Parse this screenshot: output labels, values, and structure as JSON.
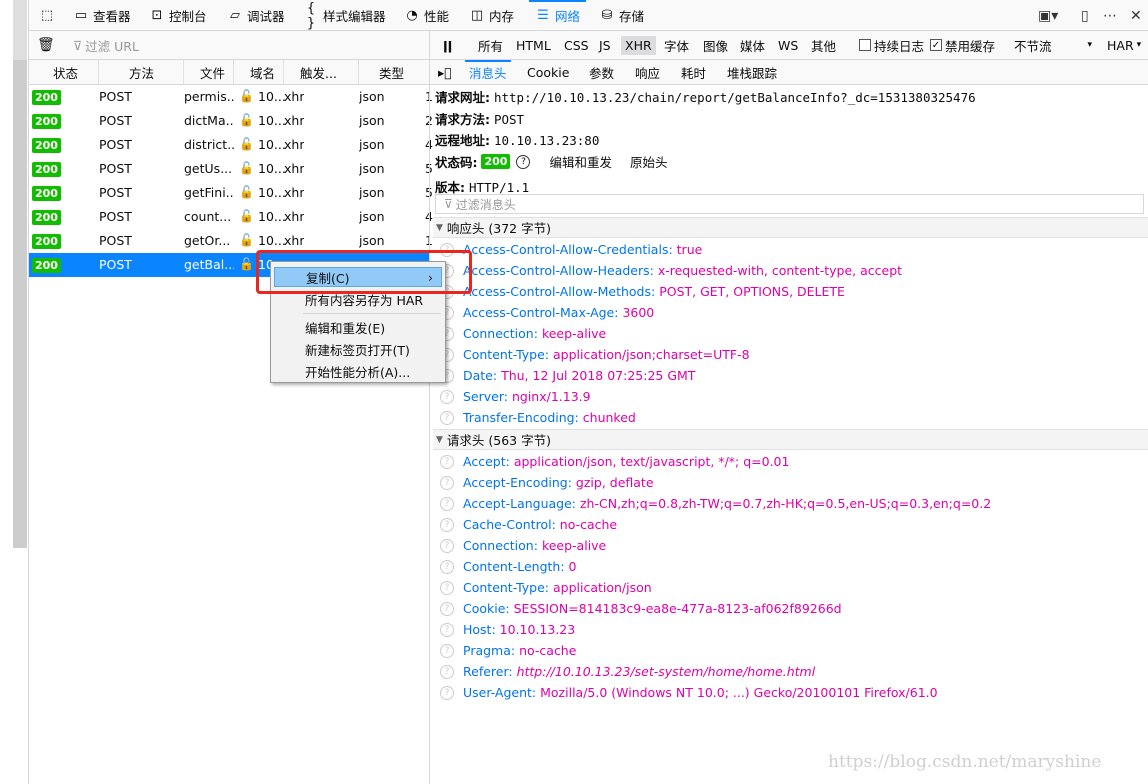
{
  "toolbox": {
    "tabs": [
      {
        "label": "查看器",
        "icon": "inspector-icon"
      },
      {
        "label": "控制台",
        "icon": "console-icon"
      },
      {
        "label": "调试器",
        "icon": "debugger-icon"
      },
      {
        "label": "样式编辑器",
        "icon": "style-editor-icon"
      },
      {
        "label": "性能",
        "icon": "performance-icon"
      },
      {
        "label": "内存",
        "icon": "memory-icon"
      },
      {
        "label": "网络",
        "icon": "network-icon"
      },
      {
        "label": "存储",
        "icon": "storage-icon"
      }
    ]
  },
  "net_toolbar": {
    "filter_placeholder": "过滤 URL",
    "types": [
      "所有",
      "HTML",
      "CSS",
      "JS",
      "XHR",
      "字体",
      "图像",
      "媒体",
      "WS",
      "其他"
    ],
    "active_type": "XHR",
    "persist_logs": "持续日志",
    "disable_cache": "禁用缓存",
    "throttle": "不节流",
    "har": "HAR"
  },
  "columns": [
    "状态",
    "方法",
    "文件",
    "域名",
    "触发...",
    "类型"
  ],
  "requests": [
    {
      "status": "200",
      "method": "POST",
      "file": "permis...",
      "domain": "10...",
      "cause": "xhr",
      "type": "json",
      "extra": "1"
    },
    {
      "status": "200",
      "method": "POST",
      "file": "dictMa...",
      "domain": "10...",
      "cause": "xhr",
      "type": "json",
      "extra": "2"
    },
    {
      "status": "200",
      "method": "POST",
      "file": "district...",
      "domain": "10...",
      "cause": "xhr",
      "type": "json",
      "extra": "4"
    },
    {
      "status": "200",
      "method": "POST",
      "file": "getUs...",
      "domain": "10...",
      "cause": "xhr",
      "type": "json",
      "extra": "5"
    },
    {
      "status": "200",
      "method": "POST",
      "file": "getFini...",
      "domain": "10...",
      "cause": "xhr",
      "type": "json",
      "extra": "5"
    },
    {
      "status": "200",
      "method": "POST",
      "file": "count...",
      "domain": "10...",
      "cause": "xhr",
      "type": "json",
      "extra": "4"
    },
    {
      "status": "200",
      "method": "POST",
      "file": "getOr...",
      "domain": "10...",
      "cause": "xhr",
      "type": "json",
      "extra": "1"
    },
    {
      "status": "200",
      "method": "POST",
      "file": "getBal...",
      "domain": "10...",
      "cause": "",
      "type": "",
      "extra": ""
    }
  ],
  "details": {
    "tabs": [
      "消息头",
      "Cookie",
      "参数",
      "响应",
      "耗时",
      "堆栈跟踪"
    ],
    "request_url_label": "请求网址:",
    "request_url": "http://10.10.13.23/chain/report/getBalanceInfo?_dc=1531380325476",
    "method_label": "请求方法:",
    "method": "POST",
    "remote_label": "远程地址:",
    "remote": "10.10.13.23:80",
    "status_label": "状态码:",
    "status": "200",
    "edit_resend": "编辑和重发",
    "raw_headers": "原始头",
    "version_label": "版本:",
    "version": "HTTP/1.1",
    "filter_placeholder": "过滤消息头",
    "response_headers_title": "响应头 (372 字节)",
    "response_headers": [
      {
        "k": "Access-Control-Allow-Credentials:",
        "v": "true"
      },
      {
        "k": "Access-Control-Allow-Headers:",
        "v": "x-requested-with, content-type, accept"
      },
      {
        "k": "Access-Control-Allow-Methods:",
        "v": "POST, GET, OPTIONS, DELETE"
      },
      {
        "k": "Access-Control-Max-Age:",
        "v": "3600"
      },
      {
        "k": "Connection:",
        "v": "keep-alive"
      },
      {
        "k": "Content-Type:",
        "v": "application/json;charset=UTF-8"
      },
      {
        "k": "Date:",
        "v": "Thu, 12 Jul 2018 07:25:25 GMT"
      },
      {
        "k": "Server:",
        "v": "nginx/1.13.9"
      },
      {
        "k": "Transfer-Encoding:",
        "v": "chunked"
      }
    ],
    "request_headers_title": "请求头 (563 字节)",
    "request_headers": [
      {
        "k": "Accept:",
        "v": "application/json, text/javascript, */*; q=0.01"
      },
      {
        "k": "Accept-Encoding:",
        "v": "gzip, deflate"
      },
      {
        "k": "Accept-Language:",
        "v": "zh-CN,zh;q=0.8,zh-TW;q=0.7,zh-HK;q=0.5,en-US;q=0.3,en;q=0.2"
      },
      {
        "k": "Cache-Control:",
        "v": "no-cache"
      },
      {
        "k": "Connection:",
        "v": "keep-alive"
      },
      {
        "k": "Content-Length:",
        "v": "0"
      },
      {
        "k": "Content-Type:",
        "v": "application/json"
      },
      {
        "k": "Cookie:",
        "v": "SESSION=814183c9-ea8e-477a-8123-af062f89266d"
      },
      {
        "k": "Host:",
        "v": "10.10.13.23"
      },
      {
        "k": "Pragma:",
        "v": "no-cache"
      },
      {
        "k": "Referer:",
        "v": "http://10.10.13.23/set-system/home/home.html"
      },
      {
        "k": "User-Agent:",
        "v": "Mozilla/5.0 (Windows NT 10.0; ...) Gecko/20100101 Firefox/61.0"
      }
    ]
  },
  "context_menu": {
    "copy": "复制(C)",
    "save_har": "所有内容另存为 HAR",
    "edit_resend": "编辑和重发(E)",
    "open_new_tab": "新建标签页打开(T)",
    "start_perf": "开始性能分析(A)..."
  },
  "watermark": "https://blog.csdn.net/maryshine",
  "colors": {
    "accent": "#0a84ff",
    "ok_badge": "#12bc00",
    "header_key": "#0074e8",
    "header_value": "#dd00a9"
  }
}
